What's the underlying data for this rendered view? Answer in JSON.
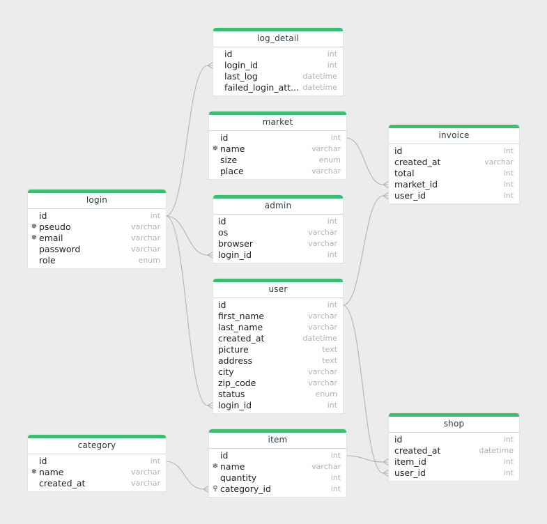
{
  "tables": [
    {
      "id": "log_detail",
      "title": "log_detail",
      "fields": [
        {
          "name": "id",
          "type": "int"
        },
        {
          "name": "login_id",
          "type": "int"
        },
        {
          "name": "last_log",
          "type": "datetime"
        },
        {
          "name": "failed_login_att...",
          "type": "datetime"
        }
      ]
    },
    {
      "id": "market",
      "title": "market",
      "fields": [
        {
          "name": "id",
          "type": "int"
        },
        {
          "name": "name",
          "type": "varchar",
          "unique": true
        },
        {
          "name": "size",
          "type": "enum"
        },
        {
          "name": "place",
          "type": "varchar"
        }
      ]
    },
    {
      "id": "invoice",
      "title": "invoice",
      "fields": [
        {
          "name": "id",
          "type": "int"
        },
        {
          "name": "created_at",
          "type": "varchar"
        },
        {
          "name": "total",
          "type": "int"
        },
        {
          "name": "market_id",
          "type": "int"
        },
        {
          "name": "user_id",
          "type": "int"
        }
      ]
    },
    {
      "id": "login",
      "title": "login",
      "fields": [
        {
          "name": "id",
          "type": "int"
        },
        {
          "name": "pseudo",
          "type": "varchar",
          "unique": true
        },
        {
          "name": "email",
          "type": "varchar",
          "unique": true
        },
        {
          "name": "password",
          "type": "varchar"
        },
        {
          "name": "role",
          "type": "enum"
        }
      ]
    },
    {
      "id": "admin",
      "title": "admin",
      "fields": [
        {
          "name": "id",
          "type": "int"
        },
        {
          "name": "os",
          "type": "varchar"
        },
        {
          "name": "browser",
          "type": "varchar"
        },
        {
          "name": "login_id",
          "type": "int"
        }
      ]
    },
    {
      "id": "user",
      "title": "user",
      "fields": [
        {
          "name": "id",
          "type": "int"
        },
        {
          "name": "first_name",
          "type": "varchar"
        },
        {
          "name": "last_name",
          "type": "varchar"
        },
        {
          "name": "created_at",
          "type": "datetime"
        },
        {
          "name": "picture",
          "type": "text"
        },
        {
          "name": "address",
          "type": "text"
        },
        {
          "name": "city",
          "type": "varchar"
        },
        {
          "name": "zip_code",
          "type": "varchar"
        },
        {
          "name": "status",
          "type": "enum"
        },
        {
          "name": "login_id",
          "type": "int"
        }
      ]
    },
    {
      "id": "shop",
      "title": "shop",
      "fields": [
        {
          "name": "id",
          "type": "int"
        },
        {
          "name": "created_at",
          "type": "datetime"
        },
        {
          "name": "item_id",
          "type": "int"
        },
        {
          "name": "user_id",
          "type": "int"
        }
      ]
    },
    {
      "id": "category",
      "title": "category",
      "fields": [
        {
          "name": "id",
          "type": "int"
        },
        {
          "name": "name",
          "type": "varchar",
          "unique": true
        },
        {
          "name": "created_at",
          "type": "varchar"
        }
      ]
    },
    {
      "id": "item",
      "title": "item",
      "fields": [
        {
          "name": "id",
          "type": "int"
        },
        {
          "name": "name",
          "type": "varchar",
          "unique": true
        },
        {
          "name": "quantity",
          "type": "int"
        },
        {
          "name": "category_id",
          "type": "int",
          "fk": true
        }
      ]
    }
  ],
  "relations": [
    {
      "from": "login.id",
      "to": "log_detail.login_id"
    },
    {
      "from": "login.id",
      "to": "admin.login_id"
    },
    {
      "from": "login.id",
      "to": "user.login_id"
    },
    {
      "from": "market.id",
      "to": "invoice.market_id"
    },
    {
      "from": "user.id",
      "to": "invoice.user_id"
    },
    {
      "from": "user.id",
      "to": "shop.user_id"
    },
    {
      "from": "item.id",
      "to": "shop.item_id"
    },
    {
      "from": "category.id",
      "to": "item.category_id"
    }
  ],
  "colors": {
    "header_accent": "#3dbd74",
    "edge": "#b3b3b3",
    "type_text": "#b3b3b3"
  },
  "icons": {
    "unique": "snowflake-icon",
    "foreign_key": "key-icon"
  }
}
